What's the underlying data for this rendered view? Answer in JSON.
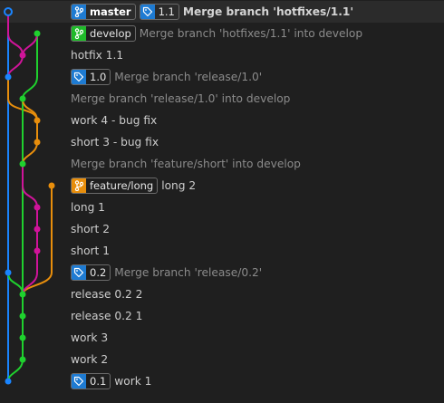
{
  "colors": {
    "blue": "#1a85ff",
    "green": "#1fd12e",
    "magenta": "#d0149a",
    "orange": "#e88e0c",
    "tag_blue": "#1e7bd2"
  },
  "commits": [
    {
      "message": "Merge branch 'hotfixes/1.1'",
      "style": "bold",
      "refs": [
        {
          "type": "branch",
          "label": "master",
          "color": "#1e7bd2"
        },
        {
          "type": "tag",
          "label": "1.1",
          "color": "#1e7bd2"
        }
      ]
    },
    {
      "message": "Merge branch 'hotfixes/1.1' into develop",
      "style": "dim",
      "refs": [
        {
          "type": "branch",
          "label": "develop",
          "color": "#1fbb2a"
        }
      ]
    },
    {
      "message": "hotfix 1.1",
      "style": "normal",
      "refs": []
    },
    {
      "message": "Merge branch 'release/1.0'",
      "style": "dim",
      "refs": [
        {
          "type": "tag",
          "label": "1.0",
          "color": "#1e7bd2"
        }
      ]
    },
    {
      "message": "Merge branch 'release/1.0' into develop",
      "style": "dim",
      "refs": []
    },
    {
      "message": "work 4 - bug fix",
      "style": "normal",
      "refs": []
    },
    {
      "message": "short 3 - bug fix",
      "style": "normal",
      "refs": []
    },
    {
      "message": "Merge branch 'feature/short' into develop",
      "style": "dim",
      "refs": []
    },
    {
      "message": "long 2",
      "style": "normal",
      "refs": [
        {
          "type": "branch",
          "label": "feature/long",
          "color": "#e88e0c"
        }
      ]
    },
    {
      "message": "long 1",
      "style": "normal",
      "refs": []
    },
    {
      "message": "short 2",
      "style": "normal",
      "refs": []
    },
    {
      "message": "short 1",
      "style": "normal",
      "refs": []
    },
    {
      "message": "Merge branch 'release/0.2'",
      "style": "dim",
      "refs": [
        {
          "type": "tag",
          "label": "0.2",
          "color": "#1e7bd2"
        }
      ]
    },
    {
      "message": "release 0.2 2",
      "style": "normal",
      "refs": []
    },
    {
      "message": "release 0.2 1",
      "style": "normal",
      "refs": []
    },
    {
      "message": "work 3",
      "style": "normal",
      "refs": []
    },
    {
      "message": "work 2",
      "style": "normal",
      "refs": []
    },
    {
      "message": "work 1",
      "style": "normal",
      "refs": [
        {
          "type": "tag",
          "label": "0.1",
          "color": "#1e7bd2"
        }
      ]
    }
  ],
  "graph": {
    "nodes": [
      {
        "row": 0,
        "lane": 0,
        "color": "blue",
        "hollow": true
      },
      {
        "row": 1,
        "lane": 2,
        "color": "green",
        "hollow": false
      },
      {
        "row": 2,
        "lane": 1,
        "color": "magenta",
        "hollow": false
      },
      {
        "row": 3,
        "lane": 0,
        "color": "blue",
        "hollow": false
      },
      {
        "row": 4,
        "lane": 1,
        "color": "green",
        "hollow": false
      },
      {
        "row": 5,
        "lane": 2,
        "color": "orange",
        "hollow": false
      },
      {
        "row": 6,
        "lane": 2,
        "color": "orange",
        "hollow": false
      },
      {
        "row": 7,
        "lane": 1,
        "color": "green",
        "hollow": false
      },
      {
        "row": 8,
        "lane": 3,
        "color": "orange",
        "hollow": false
      },
      {
        "row": 9,
        "lane": 2,
        "color": "magenta",
        "hollow": false
      },
      {
        "row": 10,
        "lane": 2,
        "color": "magenta",
        "hollow": false
      },
      {
        "row": 11,
        "lane": 2,
        "color": "magenta",
        "hollow": false
      },
      {
        "row": 12,
        "lane": 0,
        "color": "blue",
        "hollow": false
      },
      {
        "row": 13,
        "lane": 1,
        "color": "green",
        "hollow": false
      },
      {
        "row": 14,
        "lane": 1,
        "color": "green",
        "hollow": false
      },
      {
        "row": 15,
        "lane": 1,
        "color": "green",
        "hollow": false
      },
      {
        "row": 16,
        "lane": 1,
        "color": "green",
        "hollow": false
      },
      {
        "row": 17,
        "lane": 0,
        "color": "blue",
        "hollow": false
      }
    ],
    "edges": [
      {
        "color": "blue",
        "from": [
          0,
          0
        ],
        "to": [
          3,
          0
        ]
      },
      {
        "color": "magenta",
        "from": [
          0,
          0
        ],
        "to": [
          2,
          1
        ]
      },
      {
        "color": "green",
        "from": [
          1,
          2
        ],
        "to": [
          4,
          1
        ]
      },
      {
        "color": "magenta",
        "from": [
          1,
          2
        ],
        "to": [
          2,
          1
        ]
      },
      {
        "color": "magenta",
        "from": [
          2,
          1
        ],
        "to": [
          3,
          0
        ]
      },
      {
        "color": "blue",
        "from": [
          3,
          0
        ],
        "to": [
          12,
          0
        ]
      },
      {
        "color": "orange",
        "from": [
          3,
          0
        ],
        "to": [
          5,
          2
        ]
      },
      {
        "color": "green",
        "from": [
          4,
          1
        ],
        "to": [
          7,
          1
        ]
      },
      {
        "color": "orange",
        "from": [
          4,
          1
        ],
        "to": [
          5,
          2
        ]
      },
      {
        "color": "orange",
        "from": [
          5,
          2
        ],
        "to": [
          6,
          2
        ]
      },
      {
        "color": "orange",
        "from": [
          6,
          2
        ],
        "to": [
          7,
          1
        ]
      },
      {
        "color": "green",
        "from": [
          7,
          1
        ],
        "to": [
          13,
          1
        ]
      },
      {
        "color": "magenta",
        "from": [
          7,
          1
        ],
        "to": [
          9,
          2
        ]
      },
      {
        "color": "orange",
        "from": [
          8,
          3
        ],
        "to": [
          13,
          1
        ]
      },
      {
        "color": "magenta",
        "from": [
          9,
          2
        ],
        "to": [
          10,
          2
        ]
      },
      {
        "color": "magenta",
        "from": [
          10,
          2
        ],
        "to": [
          11,
          2
        ]
      },
      {
        "color": "magenta",
        "from": [
          11,
          2
        ],
        "to": [
          13,
          1
        ]
      },
      {
        "color": "blue",
        "from": [
          12,
          0
        ],
        "to": [
          17,
          0
        ]
      },
      {
        "color": "green",
        "from": [
          12,
          0
        ],
        "to": [
          13,
          1
        ]
      },
      {
        "color": "green",
        "from": [
          13,
          1
        ],
        "to": [
          16,
          1
        ]
      },
      {
        "color": "green",
        "from": [
          16,
          1
        ],
        "to": [
          17,
          0
        ]
      }
    ]
  }
}
